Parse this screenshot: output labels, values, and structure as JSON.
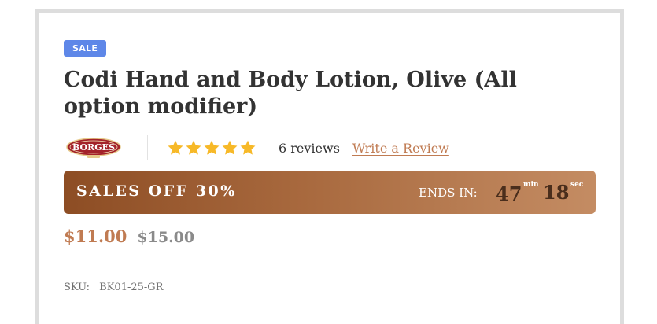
{
  "product": {
    "badge": "SALE",
    "title": "Codi Hand and Body Lotion, Olive (All option modifier)",
    "brand": {
      "name": "BORGES",
      "logo_icon": "borges-logo"
    },
    "rating": {
      "stars": 5,
      "max_stars": 5,
      "star_color": "#f7b928",
      "reviews_text": "6 reviews",
      "write_review_label": "Write a Review"
    },
    "sale_banner": {
      "label": "SALES OFF 30%",
      "ends_in_label": "ENDS IN:",
      "minutes": "47",
      "minutes_unit": "min",
      "seconds": "18",
      "seconds_unit": "sec"
    },
    "price": {
      "current": "$11.00",
      "original": "$15.00"
    },
    "sku": {
      "label": "SKU:",
      "value": "BK01-25-GR"
    }
  },
  "colors": {
    "badge": "#5e87e8",
    "accent": "#c07b52",
    "title": "#333333",
    "banner_start": "#8d4d24",
    "banner_end": "#c48c63"
  }
}
